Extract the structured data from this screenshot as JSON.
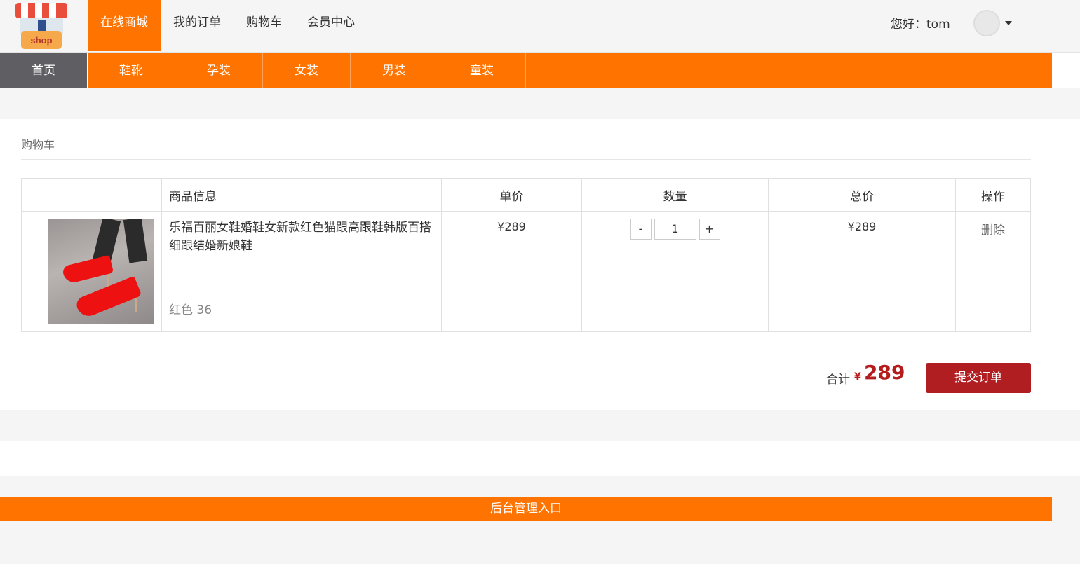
{
  "header": {
    "logo_text": "shop",
    "nav": [
      {
        "label": "在线商城",
        "active": true
      },
      {
        "label": "我的订单",
        "active": false
      },
      {
        "label": "购物车",
        "active": false
      },
      {
        "label": "会员中心",
        "active": false
      }
    ],
    "greeting": "您好：tom"
  },
  "categories": [
    {
      "label": "首页"
    },
    {
      "label": "鞋靴"
    },
    {
      "label": "孕装"
    },
    {
      "label": "女装"
    },
    {
      "label": "男装"
    },
    {
      "label": "童装"
    }
  ],
  "cart": {
    "title": "购物车",
    "columns": {
      "image": "",
      "info": "商品信息",
      "price": "单价",
      "qty": "数量",
      "total": "总价",
      "op": "操作"
    },
    "items": [
      {
        "name": "乐福百丽女鞋婚鞋女新款红色猫跟高跟鞋韩版百搭细跟结婚新娘鞋",
        "spec": "红色 36",
        "price": "¥289",
        "qty": "1",
        "total": "¥289",
        "delete_label": "删除",
        "minus_label": "-",
        "plus_label": "+"
      }
    ],
    "sum_label": "合计",
    "sum_currency": "¥",
    "sum_value": "289",
    "submit_label": "提交订单"
  },
  "footer": {
    "admin_label": "后台管理入口"
  },
  "colors": {
    "accent": "#ff7300",
    "home_tab": "#5f5f63",
    "submit": "#b01e22",
    "price_red": "#b71c1c"
  }
}
